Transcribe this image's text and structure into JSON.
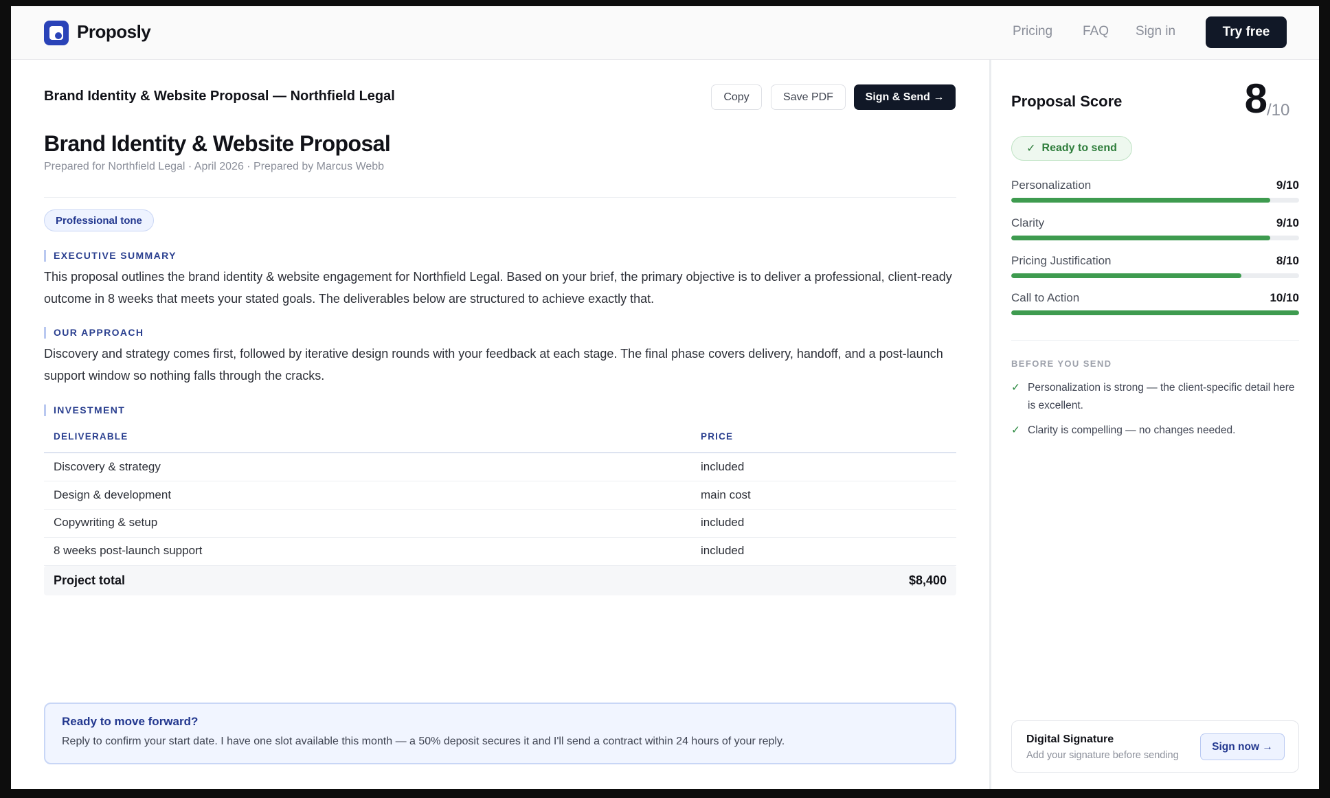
{
  "nav": {
    "brand": "Proposly",
    "links": [
      "Pricing",
      "FAQ",
      "Sign in"
    ],
    "cta": "Try free"
  },
  "toolbar": {
    "doc_title": "Brand Identity & Website Proposal — Northfield Legal",
    "copy": "Copy",
    "save_pdf": "Save PDF",
    "sign_send": "Sign & Send →"
  },
  "proposal": {
    "title": "Brand Identity & Website Proposal",
    "meta": "Prepared for Northfield Legal · April 2026 · Prepared by Marcus Webb",
    "tone": "Professional tone",
    "sections": {
      "summary_label": "EXECUTIVE SUMMARY",
      "summary_text": "This proposal outlines the brand identity & website engagement for Northfield Legal. Based on your brief, the primary objective is to deliver a professional, client-ready outcome in 8 weeks that meets your stated goals. The deliverables below are structured to achieve exactly that.",
      "approach_label": "OUR APPROACH",
      "approach_text": "Discovery and strategy comes first, followed by iterative design rounds with your feedback at each stage. The final phase covers delivery, handoff, and a post-launch support window so nothing falls through the cracks.",
      "investment_label": "INVESTMENT"
    },
    "table": {
      "headers": [
        "DELIVERABLE",
        "PRICE"
      ],
      "rows": [
        [
          "Discovery & strategy",
          "included"
        ],
        [
          "Design & development",
          "main cost"
        ],
        [
          "Copywriting & setup",
          "included"
        ],
        [
          "8 weeks post-launch support",
          "included"
        ]
      ],
      "total_label": "Project total",
      "total_value": "$8,400"
    },
    "cta": {
      "title": "Ready to move forward?",
      "text": "Reply to confirm your start date. I have one slot available this month — a 50% deposit secures it and I'll send a contract within 24 hours of your reply."
    }
  },
  "sidebar": {
    "score_title": "Proposal Score",
    "score": "8",
    "score_den": "/10",
    "status": "Ready to send",
    "metrics": [
      {
        "label": "Personalization",
        "value": "9/10",
        "fraction": 0.9
      },
      {
        "label": "Clarity",
        "value": "9/10",
        "fraction": 0.9
      },
      {
        "label": "Pricing Justification",
        "value": "8/10",
        "fraction": 0.8
      },
      {
        "label": "Call to Action",
        "value": "10/10",
        "fraction": 1.0
      }
    ],
    "before_label": "BEFORE YOU SEND",
    "tips": [
      "Personalization is strong — the client-specific detail here is excellent.",
      "Clarity is compelling — no changes needed."
    ],
    "signature": {
      "title": "Digital Signature",
      "subtitle": "Add your signature before sending",
      "button": "Sign now →"
    }
  },
  "colors": {
    "accent": "#2a43b8",
    "dark": "#111827",
    "success": "#3e9b4f"
  },
  "icons": {
    "logo": "proposly-logo-icon",
    "check": "check-icon"
  }
}
